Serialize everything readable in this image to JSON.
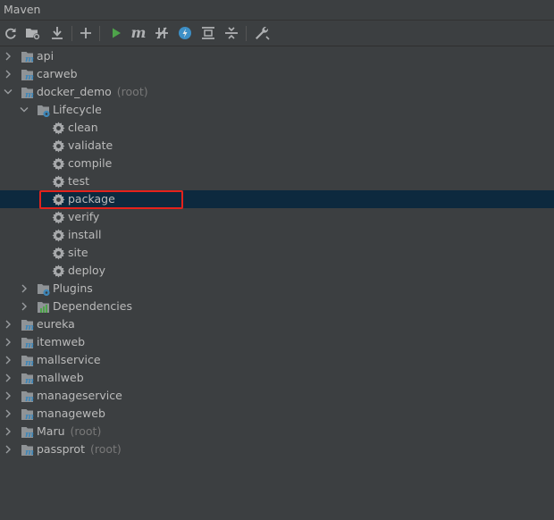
{
  "title": "Maven",
  "toolbar": {
    "buttons": [
      {
        "name": "reload-icon"
      },
      {
        "name": "generate-sources-icon"
      },
      {
        "name": "download-icon"
      },
      {
        "name": "add-icon"
      },
      {
        "name": "run-icon"
      },
      {
        "name": "execute-goal-icon"
      },
      {
        "name": "toggle-offline-icon"
      },
      {
        "name": "skip-tests-icon"
      },
      {
        "name": "show-dependencies-icon"
      },
      {
        "name": "collapse-all-icon"
      },
      {
        "name": "settings-icon"
      }
    ]
  },
  "tree": [
    {
      "label": "api",
      "suffix": "",
      "level": 0,
      "kind": "module",
      "arrow": "right"
    },
    {
      "label": "carweb",
      "suffix": "",
      "level": 0,
      "kind": "module",
      "arrow": "right"
    },
    {
      "label": "docker_demo",
      "suffix": "(root)",
      "level": 0,
      "kind": "module",
      "arrow": "down"
    },
    {
      "label": "Lifecycle",
      "suffix": "",
      "level": 1,
      "kind": "folder",
      "arrow": "down"
    },
    {
      "label": "clean",
      "suffix": "",
      "level": 2,
      "kind": "goal",
      "arrow": ""
    },
    {
      "label": "validate",
      "suffix": "",
      "level": 2,
      "kind": "goal",
      "arrow": ""
    },
    {
      "label": "compile",
      "suffix": "",
      "level": 2,
      "kind": "goal",
      "arrow": ""
    },
    {
      "label": "test",
      "suffix": "",
      "level": 2,
      "kind": "goal",
      "arrow": ""
    },
    {
      "label": "package",
      "suffix": "",
      "level": 2,
      "kind": "goal",
      "arrow": "",
      "selected": true
    },
    {
      "label": "verify",
      "suffix": "",
      "level": 2,
      "kind": "goal",
      "arrow": ""
    },
    {
      "label": "install",
      "suffix": "",
      "level": 2,
      "kind": "goal",
      "arrow": ""
    },
    {
      "label": "site",
      "suffix": "",
      "level": 2,
      "kind": "goal",
      "arrow": ""
    },
    {
      "label": "deploy",
      "suffix": "",
      "level": 2,
      "kind": "goal",
      "arrow": ""
    },
    {
      "label": "Plugins",
      "suffix": "",
      "level": 1,
      "kind": "folder",
      "arrow": "right"
    },
    {
      "label": "Dependencies",
      "suffix": "",
      "level": 1,
      "kind": "deps",
      "arrow": "right"
    },
    {
      "label": "eureka",
      "suffix": "",
      "level": 0,
      "kind": "module",
      "arrow": "right"
    },
    {
      "label": "itemweb",
      "suffix": "",
      "level": 0,
      "kind": "module",
      "arrow": "right"
    },
    {
      "label": "mallservice",
      "suffix": "",
      "level": 0,
      "kind": "module",
      "arrow": "right"
    },
    {
      "label": "mallweb",
      "suffix": "",
      "level": 0,
      "kind": "module",
      "arrow": "right"
    },
    {
      "label": "manageservice",
      "suffix": "",
      "level": 0,
      "kind": "module",
      "arrow": "right"
    },
    {
      "label": "manageweb",
      "suffix": "",
      "level": 0,
      "kind": "module",
      "arrow": "right"
    },
    {
      "label": "Maru",
      "suffix": "(root)",
      "level": 0,
      "kind": "module",
      "arrow": "right"
    },
    {
      "label": "passprot",
      "suffix": "(root)",
      "level": 0,
      "kind": "module",
      "arrow": "right"
    }
  ]
}
